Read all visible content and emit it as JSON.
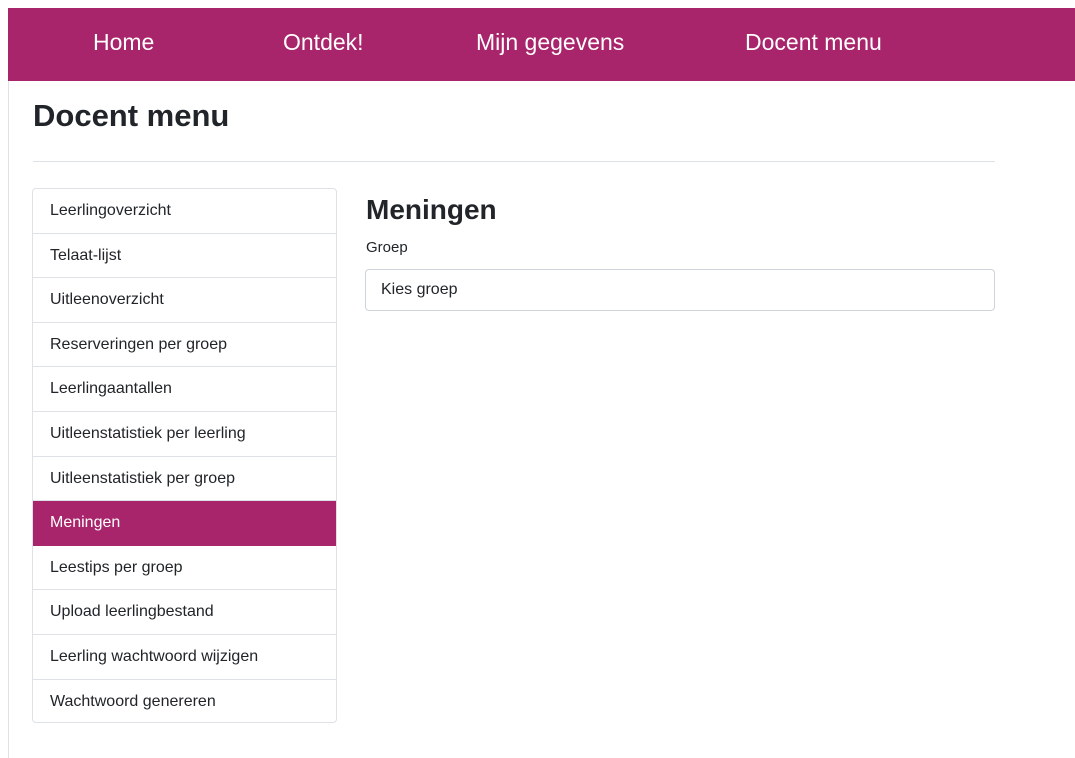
{
  "nav": {
    "items": [
      {
        "label": "Home"
      },
      {
        "label": "Ontdek!"
      },
      {
        "label": "Mijn gegevens"
      },
      {
        "label": "Docent menu"
      }
    ]
  },
  "page": {
    "title": "Docent menu"
  },
  "sidebar": {
    "active_index": 7,
    "items": [
      {
        "label": "Leerlingoverzicht"
      },
      {
        "label": "Telaat-lijst"
      },
      {
        "label": "Uitleenoverzicht"
      },
      {
        "label": "Reserveringen per groep"
      },
      {
        "label": "Leerlingaantallen"
      },
      {
        "label": "Uitleenstatistiek per leerling"
      },
      {
        "label": "Uitleenstatistiek per groep"
      },
      {
        "label": "Meningen"
      },
      {
        "label": "Leestips per groep"
      },
      {
        "label": "Upload leerlingbestand"
      },
      {
        "label": "Leerling wachtwoord wijzigen"
      },
      {
        "label": "Wachtwoord genereren"
      }
    ]
  },
  "main": {
    "title": "Meningen",
    "group_label": "Groep",
    "group_select_value": "Kies groep"
  },
  "colors": {
    "brand": "#a8246b",
    "border": "#dee2e6",
    "text": "#212529"
  }
}
